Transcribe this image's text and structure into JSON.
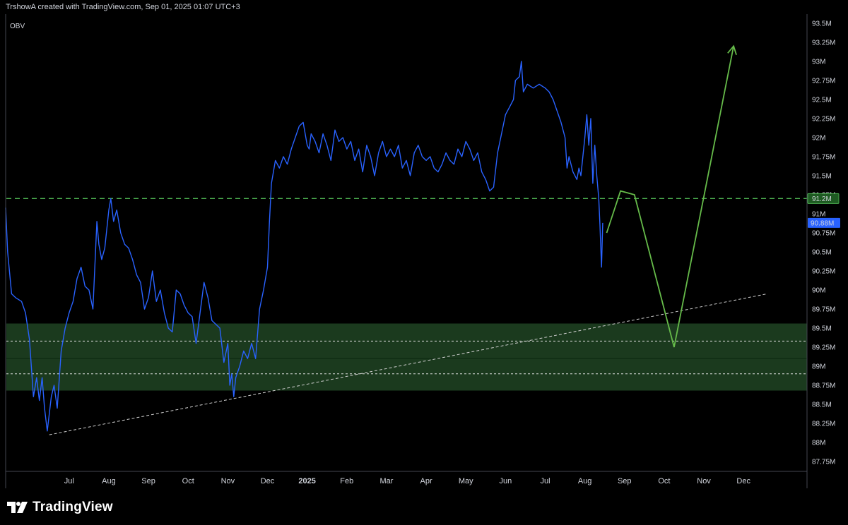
{
  "header": {
    "credit": "TrshowA created with TradingView.com, Sep 01, 2025 01:07 UTC+3"
  },
  "footer": {
    "brand": "TradingView",
    "logo_icon": "tradingview-logo-icon"
  },
  "colors": {
    "background": "#000000",
    "obv_line": "#2962ff",
    "zone_fill": "#1b3a1e",
    "green_line": "#4caf50",
    "projection": "#66bb4a",
    "trendline": "#d0d0d0",
    "last_value_badge": "#2962ff",
    "level_badge": "#1e5a22"
  },
  "chart_data": {
    "type": "line",
    "pane_label": "OBV",
    "y_unit": "M",
    "ylim": [
      87.62,
      93.62
    ],
    "y_ticks": [
      "87.75M",
      "88M",
      "88.25M",
      "88.5M",
      "88.75M",
      "89M",
      "89.25M",
      "89.5M",
      "89.75M",
      "90M",
      "90.25M",
      "90.5M",
      "90.75M",
      "91M",
      "91.25M",
      "91.5M",
      "91.75M",
      "92M",
      "92.25M",
      "92.5M",
      "92.75M",
      "93M",
      "93.25M",
      "93.5M"
    ],
    "y_tick_values": [
      87.75,
      88,
      88.25,
      88.5,
      88.75,
      89,
      89.25,
      89.5,
      89.75,
      90,
      90.25,
      90.5,
      90.75,
      91,
      91.25,
      91.5,
      91.75,
      92,
      92.25,
      92.5,
      92.75,
      93,
      93.25,
      93.5
    ],
    "x_ticks": [
      {
        "label": "Jul",
        "t": 6.0
      },
      {
        "label": "Aug",
        "t": 7.0
      },
      {
        "label": "Sep",
        "t": 8.0
      },
      {
        "label": "Oct",
        "t": 9.0
      },
      {
        "label": "Nov",
        "t": 10.0
      },
      {
        "label": "Dec",
        "t": 11.0
      },
      {
        "label": "2025",
        "t": 12.0
      },
      {
        "label": "Feb",
        "t": 13.0
      },
      {
        "label": "Mar",
        "t": 14.0
      },
      {
        "label": "Apr",
        "t": 15.0
      },
      {
        "label": "May",
        "t": 16.0
      },
      {
        "label": "Jun",
        "t": 17.0
      },
      {
        "label": "Jul",
        "t": 18.0
      },
      {
        "label": "Aug",
        "t": 19.0
      },
      {
        "label": "Sep",
        "t": 20.0
      },
      {
        "label": "Oct",
        "t": 21.0
      },
      {
        "label": "Nov",
        "t": 22.0
      },
      {
        "label": "Dec",
        "t": 23.0
      }
    ],
    "x_range": [
      4.4,
      24.6
    ],
    "series": [
      {
        "values": [
          [
            4.4,
            91.08
          ],
          [
            4.45,
            90.5
          ],
          [
            4.55,
            89.95
          ],
          [
            4.65,
            89.9
          ],
          [
            4.8,
            89.85
          ],
          [
            4.9,
            89.7
          ],
          [
            5.0,
            89.35
          ],
          [
            5.1,
            88.6
          ],
          [
            5.18,
            88.85
          ],
          [
            5.25,
            88.55
          ],
          [
            5.32,
            88.85
          ],
          [
            5.38,
            88.45
          ],
          [
            5.45,
            88.15
          ],
          [
            5.55,
            88.6
          ],
          [
            5.62,
            88.75
          ],
          [
            5.7,
            88.45
          ],
          [
            5.8,
            89.2
          ],
          [
            5.9,
            89.5
          ],
          [
            6.0,
            89.7
          ],
          [
            6.1,
            89.85
          ],
          [
            6.2,
            90.15
          ],
          [
            6.3,
            90.3
          ],
          [
            6.4,
            90.05
          ],
          [
            6.5,
            90.0
          ],
          [
            6.6,
            89.75
          ],
          [
            6.7,
            90.9
          ],
          [
            6.75,
            90.6
          ],
          [
            6.82,
            90.4
          ],
          [
            6.9,
            90.55
          ],
          [
            7.0,
            91.05
          ],
          [
            7.05,
            91.2
          ],
          [
            7.12,
            90.9
          ],
          [
            7.2,
            91.05
          ],
          [
            7.3,
            90.75
          ],
          [
            7.4,
            90.6
          ],
          [
            7.5,
            90.55
          ],
          [
            7.6,
            90.4
          ],
          [
            7.7,
            90.2
          ],
          [
            7.8,
            90.1
          ],
          [
            7.9,
            89.75
          ],
          [
            8.0,
            89.9
          ],
          [
            8.1,
            90.25
          ],
          [
            8.2,
            89.85
          ],
          [
            8.3,
            90.0
          ],
          [
            8.4,
            89.7
          ],
          [
            8.5,
            89.5
          ],
          [
            8.6,
            89.45
          ],
          [
            8.7,
            90.0
          ],
          [
            8.8,
            89.95
          ],
          [
            8.9,
            89.8
          ],
          [
            9.0,
            89.7
          ],
          [
            9.1,
            89.65
          ],
          [
            9.2,
            89.3
          ],
          [
            9.3,
            89.7
          ],
          [
            9.4,
            90.1
          ],
          [
            9.5,
            89.9
          ],
          [
            9.6,
            89.6
          ],
          [
            9.7,
            89.55
          ],
          [
            9.8,
            89.5
          ],
          [
            9.9,
            89.05
          ],
          [
            10.0,
            89.3
          ],
          [
            10.05,
            88.75
          ],
          [
            10.1,
            88.9
          ],
          [
            10.15,
            88.6
          ],
          [
            10.2,
            88.85
          ],
          [
            10.3,
            89.0
          ],
          [
            10.4,
            89.2
          ],
          [
            10.5,
            89.1
          ],
          [
            10.6,
            89.3
          ],
          [
            10.7,
            89.1
          ],
          [
            10.8,
            89.75
          ],
          [
            10.9,
            90.0
          ],
          [
            11.0,
            90.3
          ],
          [
            11.05,
            90.9
          ],
          [
            11.1,
            91.4
          ],
          [
            11.15,
            91.55
          ],
          [
            11.2,
            91.7
          ],
          [
            11.3,
            91.6
          ],
          [
            11.4,
            91.75
          ],
          [
            11.5,
            91.65
          ],
          [
            11.6,
            91.85
          ],
          [
            11.7,
            92.0
          ],
          [
            11.8,
            92.15
          ],
          [
            11.9,
            92.2
          ],
          [
            12.0,
            91.9
          ],
          [
            12.05,
            91.85
          ],
          [
            12.1,
            92.05
          ],
          [
            12.2,
            91.95
          ],
          [
            12.3,
            91.8
          ],
          [
            12.4,
            92.05
          ],
          [
            12.5,
            91.9
          ],
          [
            12.6,
            91.7
          ],
          [
            12.7,
            92.1
          ],
          [
            12.8,
            91.95
          ],
          [
            12.9,
            92.0
          ],
          [
            13.0,
            91.85
          ],
          [
            13.1,
            91.95
          ],
          [
            13.2,
            91.7
          ],
          [
            13.3,
            91.85
          ],
          [
            13.4,
            91.55
          ],
          [
            13.5,
            91.9
          ],
          [
            13.6,
            91.75
          ],
          [
            13.7,
            91.5
          ],
          [
            13.8,
            91.8
          ],
          [
            13.9,
            91.95
          ],
          [
            14.0,
            91.75
          ],
          [
            14.1,
            91.85
          ],
          [
            14.2,
            91.75
          ],
          [
            14.3,
            91.9
          ],
          [
            14.4,
            91.6
          ],
          [
            14.5,
            91.7
          ],
          [
            14.6,
            91.5
          ],
          [
            14.7,
            91.8
          ],
          [
            14.8,
            91.9
          ],
          [
            14.9,
            91.75
          ],
          [
            15.0,
            91.7
          ],
          [
            15.1,
            91.75
          ],
          [
            15.2,
            91.6
          ],
          [
            15.3,
            91.55
          ],
          [
            15.4,
            91.65
          ],
          [
            15.5,
            91.8
          ],
          [
            15.6,
            91.7
          ],
          [
            15.7,
            91.65
          ],
          [
            15.8,
            91.85
          ],
          [
            15.9,
            91.75
          ],
          [
            16.0,
            91.95
          ],
          [
            16.1,
            91.85
          ],
          [
            16.2,
            91.7
          ],
          [
            16.3,
            91.8
          ],
          [
            16.4,
            91.55
          ],
          [
            16.5,
            91.45
          ],
          [
            16.6,
            91.3
          ],
          [
            16.7,
            91.35
          ],
          [
            16.8,
            91.8
          ],
          [
            16.9,
            92.05
          ],
          [
            17.0,
            92.3
          ],
          [
            17.1,
            92.4
          ],
          [
            17.2,
            92.5
          ],
          [
            17.25,
            92.75
          ],
          [
            17.35,
            92.8
          ],
          [
            17.4,
            93.0
          ],
          [
            17.45,
            92.6
          ],
          [
            17.55,
            92.7
          ],
          [
            17.7,
            92.65
          ],
          [
            17.85,
            92.7
          ],
          [
            18.0,
            92.65
          ],
          [
            18.1,
            92.6
          ],
          [
            18.2,
            92.5
          ],
          [
            18.3,
            92.35
          ],
          [
            18.4,
            92.2
          ],
          [
            18.5,
            92.0
          ],
          [
            18.55,
            91.6
          ],
          [
            18.6,
            91.75
          ],
          [
            18.7,
            91.55
          ],
          [
            18.8,
            91.45
          ],
          [
            18.85,
            91.6
          ],
          [
            18.9,
            91.5
          ],
          [
            19.0,
            92.0
          ],
          [
            19.05,
            92.3
          ],
          [
            19.1,
            91.9
          ],
          [
            19.15,
            92.25
          ],
          [
            19.2,
            91.4
          ],
          [
            19.25,
            91.9
          ],
          [
            19.3,
            91.5
          ],
          [
            19.35,
            91.2
          ],
          [
            19.38,
            90.85
          ],
          [
            19.42,
            90.3
          ],
          [
            19.45,
            90.88
          ]
        ]
      }
    ],
    "horizontal_level": 91.2,
    "last_value": 90.88,
    "badges": {
      "level": "91.2M",
      "last": "90.88M"
    },
    "demand_zone": [
      88.68,
      89.56
    ],
    "zone_inner_lines": [
      89.33,
      88.9
    ],
    "zone_separator": 89.1,
    "trendline": [
      [
        5.5,
        88.1
      ],
      [
        23.6,
        89.95
      ]
    ],
    "projection": [
      [
        19.55,
        90.75
      ],
      [
        19.9,
        91.3
      ],
      [
        20.25,
        91.25
      ],
      [
        21.25,
        89.25
      ],
      [
        22.75,
        93.2
      ]
    ]
  }
}
